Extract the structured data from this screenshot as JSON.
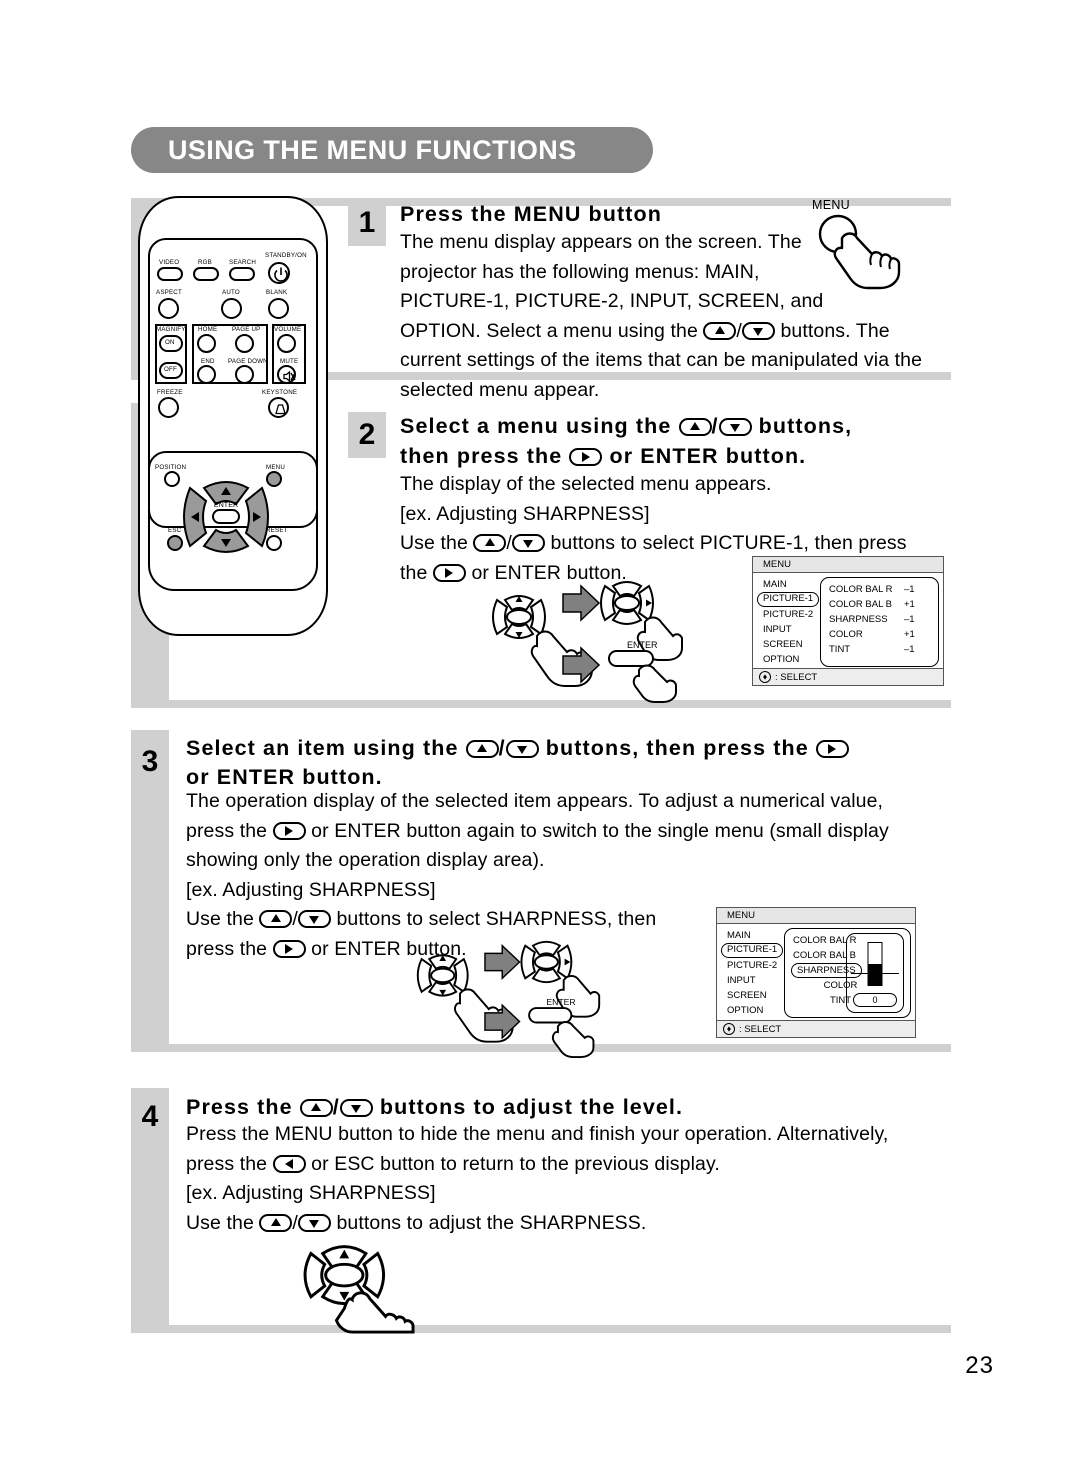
{
  "header": {
    "title": "USING THE MENU FUNCTIONS"
  },
  "page_number": "23",
  "remote": {
    "buttons": [
      {
        "label": "VIDEO"
      },
      {
        "label": "RGB"
      },
      {
        "label": "SEARCH"
      },
      {
        "label": "STANDBY/ON"
      },
      {
        "label": "ASPECT"
      },
      {
        "label": "AUTO"
      },
      {
        "label": "BLANK"
      },
      {
        "label": "MAGNIFY"
      },
      {
        "label": "ON"
      },
      {
        "label": "OFF"
      },
      {
        "label": "HOME"
      },
      {
        "label": "PAGE UP"
      },
      {
        "label": "END"
      },
      {
        "label": "PAGE DOWN"
      },
      {
        "label": "VOLUME"
      },
      {
        "label": "MUTE"
      },
      {
        "label": "FREEZE"
      },
      {
        "label": "KEYSTONE"
      },
      {
        "label": "POSITION"
      },
      {
        "label": "MENU"
      },
      {
        "label": "ENTER"
      },
      {
        "label": "ESC"
      },
      {
        "label": "RESET"
      }
    ]
  },
  "steps": [
    {
      "number": "1",
      "heading": "Press the MENU button",
      "body_lines": [
        "The menu display appears on the screen. The",
        "projector has the following menus: MAIN,",
        "PICTURE-1, PICTURE-2, INPUT, SCREEN, and",
        "OPTION. Select a menu using the ",
        " buttons. The",
        "current settings of the items that can be manipulated via the",
        "selected menu appear."
      ],
      "callout_label": "MENU"
    },
    {
      "number": "2",
      "heading_line1_a": "Select a menu using the ",
      "heading_line1_b": " buttons,",
      "heading_line2_a": "then press the ",
      "heading_line2_b": " or ENTER button.",
      "body_lines": [
        "The display of the selected menu appears.",
        "[ex. Adjusting SHARPNESS]",
        "Use the ",
        " buttons to select PICTURE-1, then press",
        "the ",
        " or ENTER button."
      ],
      "enter_label": "ENTER"
    },
    {
      "number": "3",
      "heading_line1_a": "Select an item using the ",
      "heading_line1_b": " buttons, then press the ",
      "heading_line2": "or ENTER button.",
      "body_lines": [
        "The operation display of the selected item appears. To adjust a numerical value,",
        "press the ",
        " or ENTER button again to switch to the single menu (small display",
        "showing only the operation display area).",
        "[ex. Adjusting SHARPNESS]",
        "Use the ",
        " buttons to select SHARPNESS, then",
        "press the ",
        " or ENTER button."
      ],
      "enter_label": "ENTER"
    },
    {
      "number": "4",
      "heading_a": "Press the ",
      "heading_b": " buttons to adjust the level.",
      "body_lines": [
        "Press the MENU button to hide the menu and finish your operation. Alternatively,",
        "press the ",
        " or ESC button to return to the previous display.",
        "[ex. Adjusting SHARPNESS]",
        "Use the ",
        " buttons to adjust the SHARPNESS."
      ]
    }
  ],
  "osd_menu_1": {
    "title": "MENU",
    "left_items": [
      {
        "label": "MAIN",
        "selected": false
      },
      {
        "label": "PICTURE-1",
        "selected": true
      },
      {
        "label": "PICTURE-2",
        "selected": false
      },
      {
        "label": "INPUT",
        "selected": false
      },
      {
        "label": "SCREEN",
        "selected": false
      },
      {
        "label": "OPTION",
        "selected": false
      }
    ],
    "rows": [
      {
        "name": "COLOR BAL R",
        "value": "–1"
      },
      {
        "name": "COLOR BAL B",
        "value": "+1"
      },
      {
        "name": "SHARPNESS",
        "value": "–1"
      },
      {
        "name": "COLOR",
        "value": "+1"
      },
      {
        "name": "TINT",
        "value": "–1"
      }
    ],
    "footer": ": SELECT"
  },
  "osd_menu_2": {
    "title": "MENU",
    "left_items": [
      {
        "label": "MAIN",
        "selected": false
      },
      {
        "label": "PICTURE-1",
        "selected": true
      },
      {
        "label": "PICTURE-2",
        "selected": false
      },
      {
        "label": "INPUT",
        "selected": false
      },
      {
        "label": "SCREEN",
        "selected": false
      },
      {
        "label": "OPTION",
        "selected": false
      }
    ],
    "rows": [
      {
        "name": "COLOR BAL R",
        "selected": false
      },
      {
        "name": "COLOR BAL B",
        "selected": false
      },
      {
        "name": "SHARPNESS",
        "selected": true
      },
      {
        "name": "COLOR",
        "selected": false
      },
      {
        "name": "TINT",
        "selected": false
      }
    ],
    "slider_value": "0",
    "footer": ": SELECT"
  },
  "colors": {
    "header_bg": "#878787",
    "panel_gray": "#d0d0d0",
    "dpad_gray": "#9a9a9a",
    "arrow_gray": "#808080"
  }
}
